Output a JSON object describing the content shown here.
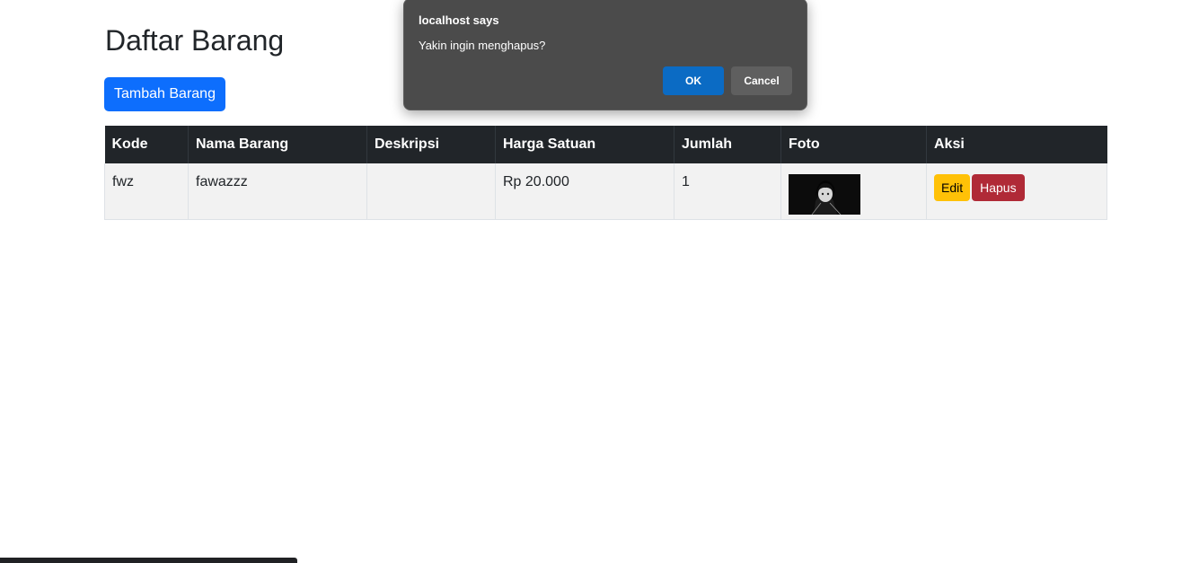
{
  "page": {
    "title": "Daftar Barang",
    "add_button_label": "Tambah Barang"
  },
  "table": {
    "headers": [
      "Kode",
      "Nama Barang",
      "Deskripsi",
      "Harga Satuan",
      "Jumlah",
      "Foto",
      "Aksi"
    ],
    "rows": [
      {
        "kode": "fwz",
        "nama": "fawazzz",
        "deskripsi": "",
        "harga": "Rp 20.000",
        "jumlah": "1",
        "foto": "thumbnail-image",
        "edit_label": "Edit",
        "hapus_label": "Hapus"
      }
    ]
  },
  "dialog": {
    "title": "localhost says",
    "message": "Yakin ingin menghapus?",
    "ok_label": "OK",
    "cancel_label": "Cancel"
  },
  "colors": {
    "primary": "#0d6efd",
    "warning": "#ffc107",
    "danger": "#b02a37",
    "table_header": "#212529",
    "dialog_bg": "#4b4b4b",
    "dialog_ok": "#0b6bc4"
  }
}
